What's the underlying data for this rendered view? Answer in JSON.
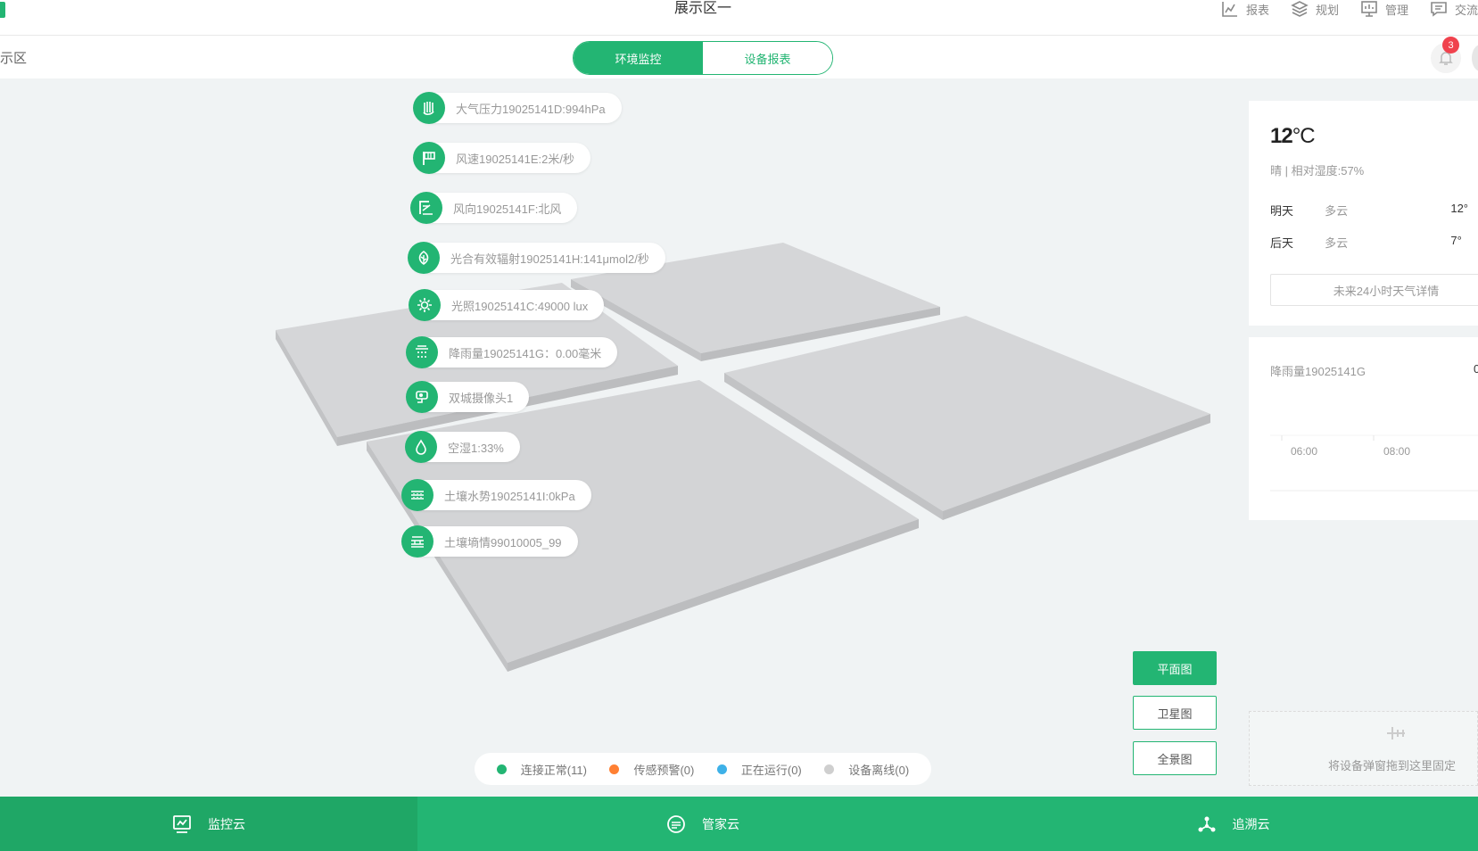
{
  "header": {
    "title": "展示区一",
    "nav": [
      {
        "label": "报表",
        "icon": "report-chart-icon"
      },
      {
        "label": "规划",
        "icon": "layers-icon"
      },
      {
        "label": "管理",
        "icon": "monitor-icon"
      },
      {
        "label": "交流",
        "icon": "chat-icon"
      }
    ]
  },
  "subbar": {
    "title": "示区",
    "tabs": [
      {
        "label": "环境监控",
        "active": true
      },
      {
        "label": "设备报表",
        "active": false
      }
    ],
    "notification_count": "3"
  },
  "devices": [
    {
      "label": "大气压力19025141D:994hPa",
      "icon": "pressure-icon"
    },
    {
      "label": "风速19025141E:2米/秒",
      "icon": "flag-icon"
    },
    {
      "label": "风向19025141F:北风",
      "icon": "wind-direction-icon"
    },
    {
      "label": "光合有效辐射19025141H:141μmol2/秒",
      "icon": "leaf-icon"
    },
    {
      "label": "光照19025141C:49000 lux",
      "icon": "sun-icon"
    },
    {
      "label": "降雨量19025141G：0.00毫米",
      "icon": "rain-icon"
    },
    {
      "label": "双城摄像头1",
      "icon": "camera-icon"
    },
    {
      "label": "空湿1:33%",
      "icon": "droplet-icon"
    },
    {
      "label": "土壤水势19025141I:0kPa",
      "icon": "soil-water-icon"
    },
    {
      "label": "土壤墒情99010005_99",
      "icon": "soil-moisture-icon"
    }
  ],
  "legend": [
    {
      "label": "连接正常(11)",
      "color": "#23b573"
    },
    {
      "label": "传感预警(0)",
      "color": "#ff8033"
    },
    {
      "label": "正在运行(0)",
      "color": "#3eb1e8"
    },
    {
      "label": "设备离线(0)",
      "color": "#cfcfcf"
    }
  ],
  "map_buttons": {
    "flat": "平面图",
    "satellite": "卫星图",
    "panorama": "全景图"
  },
  "weather": {
    "temp": "12",
    "unit": "°C",
    "desc": "晴 | 相对湿度:57%",
    "forecast": [
      {
        "day": "明天",
        "cond": "多云",
        "temp": "12°"
      },
      {
        "day": "后天",
        "cond": "多云",
        "temp": "7°"
      }
    ],
    "details_button": "未来24小时天气详情"
  },
  "rain": {
    "title": "降雨量19025141G",
    "edge_value": "0",
    "ticks": [
      "06:00",
      "08:00"
    ]
  },
  "dropzone": {
    "text": "将设备弹窗拖到这里固定"
  },
  "bottom_tabs": [
    {
      "label": "监控云",
      "icon": "monitor-cloud-icon",
      "active": true
    },
    {
      "label": "管家云",
      "icon": "butler-icon",
      "active": false
    },
    {
      "label": "追溯云",
      "icon": "trace-icon",
      "active": false
    }
  ],
  "colors": {
    "accent": "#23b573",
    "accent_dark": "#1fa766"
  }
}
